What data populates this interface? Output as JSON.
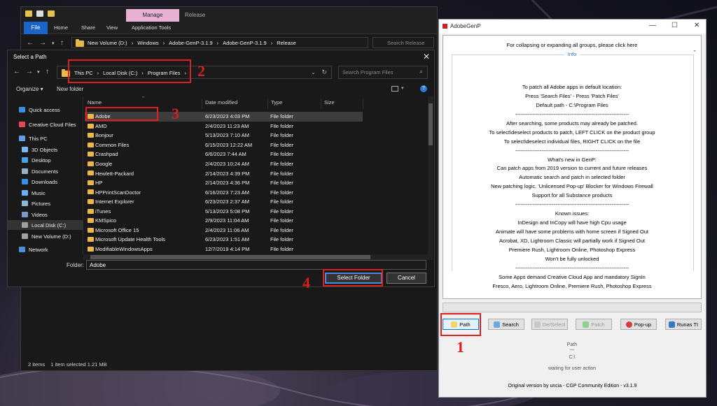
{
  "explorer": {
    "manage_tab": "Manage",
    "release_title": "Release",
    "ribbon_tabs": [
      "File",
      "Home",
      "Share",
      "View",
      "Application Tools"
    ],
    "breadcrumbs": [
      "New Volume (D:)",
      "Windows",
      "Adobe-GenP-3.1.9",
      "Adobe-GenP-3.1.9",
      "Release"
    ],
    "search_placeholder": "Search Release",
    "status": [
      "2 items",
      "1 item selected  1.21 MB"
    ]
  },
  "dialog": {
    "title": "Select a Path",
    "breadcrumbs": [
      "This PC",
      "Local Disk (C:)",
      "Program Files"
    ],
    "search_placeholder": "Search Program Files",
    "organize_label": "Organize ▾",
    "new_folder_label": "New folder",
    "nav_items": [
      {
        "label": "Quick access",
        "color": "#3a8ee6"
      },
      {
        "label": "Creative Cloud Files",
        "color": "#e34850"
      },
      {
        "label": "This PC",
        "color": "#5aa0e6"
      },
      {
        "label": "3D Objects",
        "color": "#7ab8f0"
      },
      {
        "label": "Desktop",
        "color": "#4aa0e8"
      },
      {
        "label": "Documents",
        "color": "#9ab0c8"
      },
      {
        "label": "Downloads",
        "color": "#3a8ee6"
      },
      {
        "label": "Music",
        "color": "#6ab0f0"
      },
      {
        "label": "Pictures",
        "color": "#8ab8d8"
      },
      {
        "label": "Videos",
        "color": "#7a98c8"
      },
      {
        "label": "Local Disk (C:)",
        "color": "#a0a0a0"
      },
      {
        "label": "New Volume (D:)",
        "color": "#a0a0a0"
      },
      {
        "label": "Network",
        "color": "#4a90d9"
      }
    ],
    "columns": [
      "Name",
      "Date modified",
      "Type",
      "Size"
    ],
    "files": [
      {
        "name": "Adobe",
        "date": "6/23/2023 4:03 PM",
        "type": "File folder"
      },
      {
        "name": "AMD",
        "date": "2/4/2023 11:23 AM",
        "type": "File folder"
      },
      {
        "name": "Bonjour",
        "date": "5/13/2023 7:10 AM",
        "type": "File folder"
      },
      {
        "name": "Common Files",
        "date": "6/15/2023 12:22 AM",
        "type": "File folder"
      },
      {
        "name": "Crashpad",
        "date": "6/6/2023 7:44 AM",
        "type": "File folder"
      },
      {
        "name": "Google",
        "date": "2/4/2023 10:24 AM",
        "type": "File folder"
      },
      {
        "name": "Hewlett-Packard",
        "date": "2/14/2023 4:39 PM",
        "type": "File folder"
      },
      {
        "name": "HP",
        "date": "2/14/2023 4:36 PM",
        "type": "File folder"
      },
      {
        "name": "HPPrintScanDoctor",
        "date": "6/16/2023 7:23 AM",
        "type": "File folder"
      },
      {
        "name": "Internet Explorer",
        "date": "6/23/2023 2:37 AM",
        "type": "File folder"
      },
      {
        "name": "iTunes",
        "date": "5/13/2023 5:08 PM",
        "type": "File folder"
      },
      {
        "name": "KMSpico",
        "date": "2/9/2023 11:04 AM",
        "type": "File folder"
      },
      {
        "name": "Microsoft Office 15",
        "date": "2/4/2023 11:06 AM",
        "type": "File folder"
      },
      {
        "name": "Microsoft Update Health Tools",
        "date": "6/23/2023 1:51 AM",
        "type": "File folder"
      },
      {
        "name": "ModifiableWindowsApps",
        "date": "12/7/2019 4:14 PM",
        "type": "File folder"
      }
    ],
    "folder_label": "Folder:",
    "folder_value": "Adobe",
    "select_folder_label": "Select Folder",
    "cancel_label": "Cancel"
  },
  "genp": {
    "title": "AdobeGenP",
    "collapse_text": "For collapsing or expanding all groups, please click here",
    "group_label": "Info",
    "info_lines": [
      "To patch all Adobe apps in default location:",
      "Press 'Search Files' - Press 'Patch Files'",
      "Default path - C:\\Program Files",
      "-----------------------------------------------------------------",
      "After searching, some products may already be patched.",
      "To select\\deselect products to patch, LEFT CLICK on the product group",
      "To select\\deselect individual files, RIGHT CLICK on the file",
      "-----------------------------------------------------------------",
      "What's new in GenP:",
      "Can patch apps from 2019 version to current and future releases",
      "Automatic search and patch in selected folder",
      "New patching logic. 'Unlicensed Pop-up' Blocker for Windows Firewall",
      "Support for all Substance products",
      "-----------------------------------------------------------------",
      "Known issues:",
      "InDesign and InCopy will have high Cpu usage",
      "Animate will have some problems with home screen if Signed Out",
      "Acrobat, XD, Lightroom Classic will partially work if Signed Out",
      "Premiere Rush, Lightroom Online, Photoshop Express",
      "Won't be fully unlocked",
      "-----------------------------------------------------------------",
      "Some Apps demand Creative Cloud App and mandatory SignIn",
      "Fresco, Aero, Lightroom Online, Premiere Rush, Photoshop Express"
    ],
    "buttons": {
      "path": "Path",
      "search": "Search",
      "deselect": "De/Select",
      "patch": "Patch",
      "popup": "Pop-up",
      "runas": "Runas TI"
    },
    "status_label": "Path",
    "status_sep": "---",
    "status_path": "C:\\",
    "status_wait": "waiting for user action",
    "footer": "Original version by uncia - CGP Community Edition - v3.1.9"
  },
  "annotations": [
    "1",
    "2",
    "3",
    "4"
  ]
}
